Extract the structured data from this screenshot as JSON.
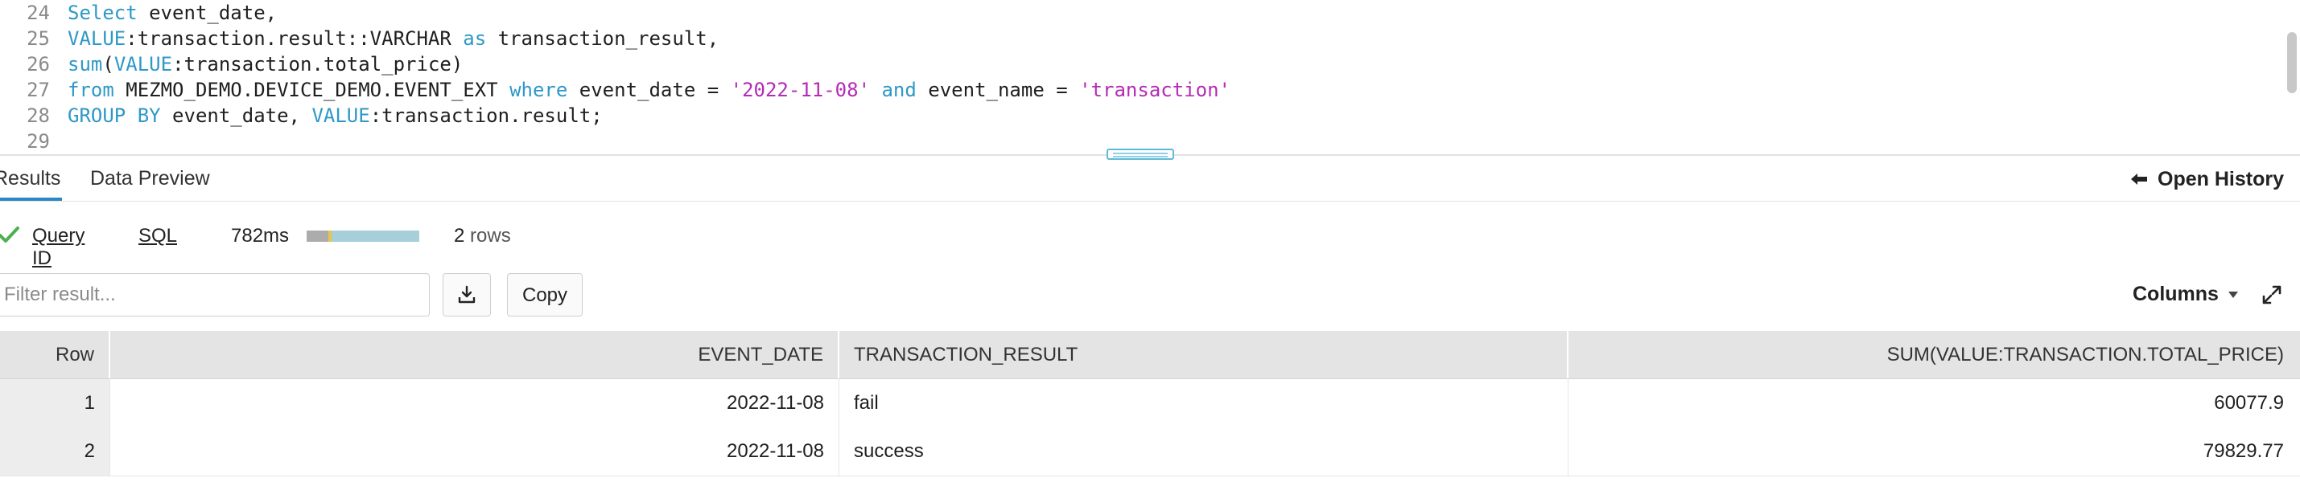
{
  "editor": {
    "lines": [
      {
        "num": "24",
        "tokens": [
          {
            "t": "Select",
            "c": "kw"
          },
          {
            "t": " event_date,",
            "c": ""
          }
        ]
      },
      {
        "num": "25",
        "tokens": [
          {
            "t": "VALUE",
            "c": "kw"
          },
          {
            "t": ":transaction.result::VARCHAR ",
            "c": ""
          },
          {
            "t": "as",
            "c": "kw"
          },
          {
            "t": " transaction_result,",
            "c": ""
          }
        ]
      },
      {
        "num": "26",
        "tokens": [
          {
            "t": "sum",
            "c": "kw"
          },
          {
            "t": "(",
            "c": ""
          },
          {
            "t": "VALUE",
            "c": "kw"
          },
          {
            "t": ":transaction.total_price)",
            "c": ""
          }
        ]
      },
      {
        "num": "27",
        "tokens": [
          {
            "t": "from",
            "c": "kw"
          },
          {
            "t": " MEZMO_DEMO.DEVICE_DEMO.EVENT_EXT ",
            "c": ""
          },
          {
            "t": "where",
            "c": "kw"
          },
          {
            "t": " event_date = ",
            "c": ""
          },
          {
            "t": "'2022-11-08'",
            "c": "str"
          },
          {
            "t": " ",
            "c": ""
          },
          {
            "t": "and",
            "c": "kw"
          },
          {
            "t": " event_name = ",
            "c": ""
          },
          {
            "t": "'transaction'",
            "c": "str"
          }
        ]
      },
      {
        "num": "28",
        "tokens": [
          {
            "t": "GROUP BY",
            "c": "kw"
          },
          {
            "t": " event_date, ",
            "c": ""
          },
          {
            "t": "VALUE",
            "c": "kw"
          },
          {
            "t": ":transaction.result;",
            "c": ""
          }
        ]
      },
      {
        "num": "29",
        "tokens": []
      }
    ]
  },
  "tabs": {
    "results": "Results",
    "data_preview": "Data Preview",
    "open_history": "Open History"
  },
  "status": {
    "query_id": "Query ID",
    "sql": "SQL",
    "duration": "782ms",
    "row_count": "2",
    "row_suffix": " rows",
    "progress_segments": [
      0.19,
      0.03,
      0.78
    ]
  },
  "filter": {
    "placeholder": "Filter result...",
    "copy_label": "Copy",
    "columns_label": "Columns"
  },
  "table": {
    "headers": [
      "Row",
      "EVENT_DATE",
      "TRANSACTION_RESULT",
      "SUM(VALUE:TRANSACTION.TOTAL_PRICE)"
    ],
    "rows": [
      [
        "1",
        "2022-11-08",
        "fail",
        "60077.9"
      ],
      [
        "2",
        "2022-11-08",
        "success",
        "79829.77"
      ]
    ]
  },
  "colors": {
    "keyword": "#2e98c7",
    "string": "#b42bb6",
    "tab_active": "#2b86c5",
    "success_check": "#4caf50"
  },
  "icons": {
    "status": "check-icon",
    "history": "back-arrow-icon",
    "download": "download-icon",
    "columns": "caret-down-icon",
    "expand": "expand-icon"
  }
}
